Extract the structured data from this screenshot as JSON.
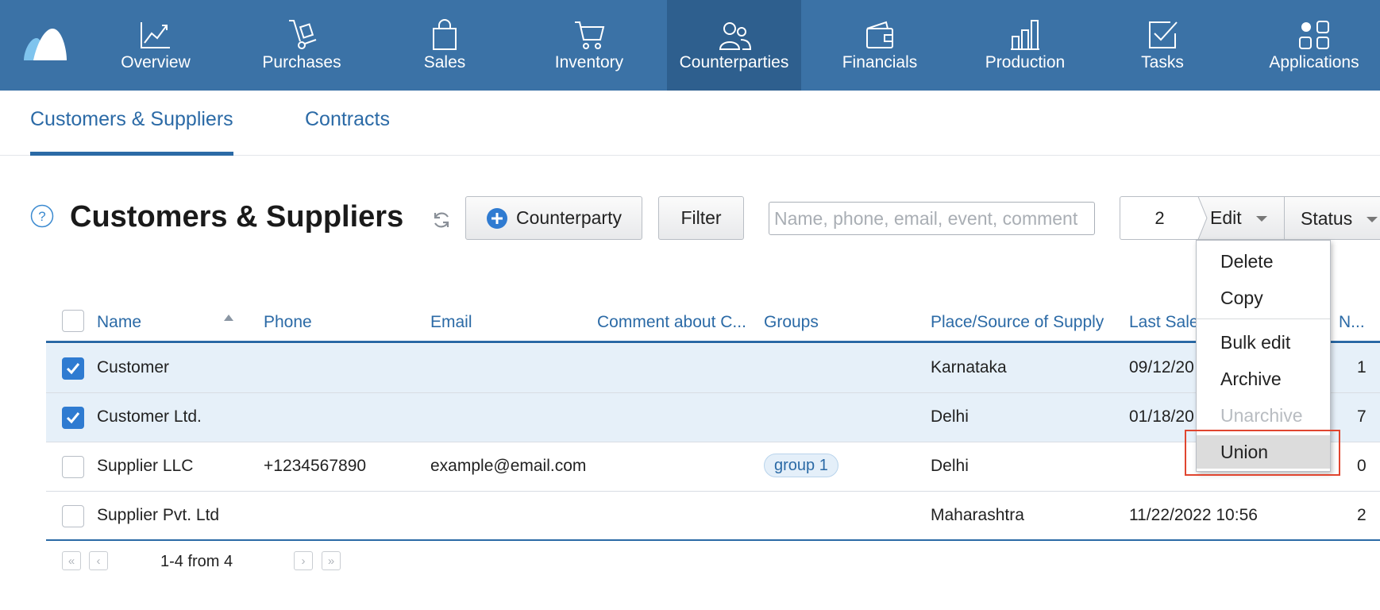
{
  "nav": {
    "items": [
      {
        "label": "Overview",
        "icon": "chart-line-icon"
      },
      {
        "label": "Purchases",
        "icon": "hand-truck-icon"
      },
      {
        "label": "Sales",
        "icon": "shopping-bag-icon"
      },
      {
        "label": "Inventory",
        "icon": "cart-icon"
      },
      {
        "label": "Counterparties",
        "icon": "people-icon"
      },
      {
        "label": "Financials",
        "icon": "wallet-icon"
      },
      {
        "label": "Production",
        "icon": "factory-icon"
      },
      {
        "label": "Tasks",
        "icon": "checkbox-icon"
      },
      {
        "label": "Applications",
        "icon": "apps-grid-icon"
      }
    ],
    "active": "Counterparties"
  },
  "subnav": {
    "tabs": [
      {
        "label": "Customers & Suppliers"
      },
      {
        "label": "Contracts"
      }
    ],
    "active": "Customers & Suppliers"
  },
  "toolbar": {
    "title": "Customers & Suppliers",
    "add_label": "Counterparty",
    "filter_label": "Filter",
    "search_placeholder": "Name, phone, email, event, comment",
    "selected_count": "2",
    "edit_label": "Edit",
    "status_label": "Status"
  },
  "table": {
    "columns": [
      "Name",
      "Phone",
      "Email",
      "Comment about C...",
      "Groups",
      "Place/Source of Supply",
      "Last Sale",
      "N..."
    ],
    "rows": [
      {
        "checked": true,
        "name": "Customer",
        "phone": "",
        "email": "",
        "comment": "",
        "group": "",
        "place": "Karnataka",
        "last_sale": "09/12/20",
        "n": "1"
      },
      {
        "checked": true,
        "name": "Customer Ltd.",
        "phone": "",
        "email": "",
        "comment": "",
        "group": "",
        "place": "Delhi",
        "last_sale": "01/18/20",
        "n": "7"
      },
      {
        "checked": false,
        "name": "Supplier LLC",
        "phone": "+1234567890",
        "email": "example@email.com",
        "comment": "",
        "group": "group 1",
        "place": "Delhi",
        "last_sale": "",
        "n": "0"
      },
      {
        "checked": false,
        "name": "Supplier Pvt. Ltd",
        "phone": "",
        "email": "",
        "comment": "",
        "group": "",
        "place": "Maharashtra",
        "last_sale": "11/22/2022 10:56",
        "n": "2"
      }
    ]
  },
  "pager": {
    "range_text": "1-4 from 4"
  },
  "edit_menu": {
    "items": [
      {
        "label": "Delete",
        "disabled": false
      },
      {
        "label": "Copy",
        "disabled": false
      },
      {
        "label": "Bulk edit",
        "disabled": false
      },
      {
        "label": "Archive",
        "disabled": false
      },
      {
        "label": "Unarchive",
        "disabled": true
      },
      {
        "label": "Union",
        "disabled": false,
        "hovered": true
      }
    ]
  },
  "colors": {
    "nav_bg": "#3b72a6",
    "nav_active_bg": "#2e5f8e",
    "accent": "#2b6aa6",
    "selected_row_bg": "#e6f0f9",
    "checkbox_on": "#2f7bd1",
    "highlight_border": "#e0452f"
  }
}
